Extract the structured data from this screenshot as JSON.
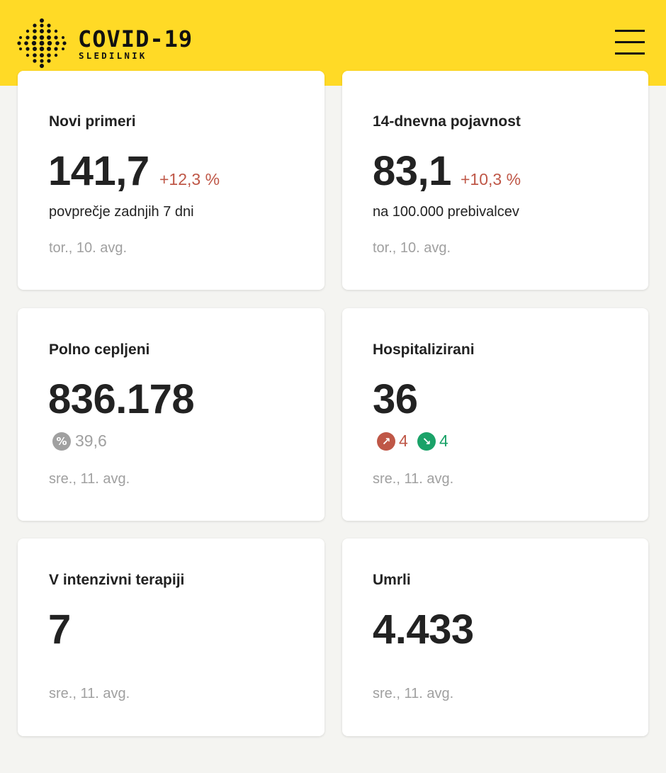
{
  "header": {
    "brand_title": "COVID-19",
    "brand_subtitle": "SLEDILNIK",
    "logo_icon": "dot-matrix-logo-icon",
    "menu_icon": "hamburger-menu-icon",
    "background_color": "#ffda26"
  },
  "cards": {
    "new_cases": {
      "title": "Novi primeri",
      "value": "141,7",
      "change": "+12,3 %",
      "subtitle": "povprečje zadnjih 7 dni",
      "date": "tor., 10. avg."
    },
    "incidence_14d": {
      "title": "14-dnevna pojavnost",
      "value": "83,1",
      "change": "+10,3 %",
      "subtitle": "na 100.000 prebivalcev",
      "date": "tor., 10. avg."
    },
    "fully_vaccinated": {
      "title": "Polno cepljeni",
      "value": "836.178",
      "percent_icon": "percent-icon",
      "percent": "39,6",
      "date": "sre., 11. avg."
    },
    "hospitalized": {
      "title": "Hospitalizirani",
      "value": "36",
      "in_icon": "arrow-up-right-icon",
      "in_value": "4",
      "out_icon": "arrow-down-right-icon",
      "out_value": "4",
      "date": "sre., 11. avg."
    },
    "icu": {
      "title": "V intenzivni terapiji",
      "value": "7",
      "date": "sre., 11. avg."
    },
    "deaths": {
      "title": "Umrli",
      "value": "4.433",
      "date": "sre., 11. avg."
    }
  },
  "colors": {
    "increase": "#bf5747",
    "decrease": "#1aa268",
    "neutral_badge": "#a0a0a0",
    "date_text": "#a0a0a0"
  }
}
